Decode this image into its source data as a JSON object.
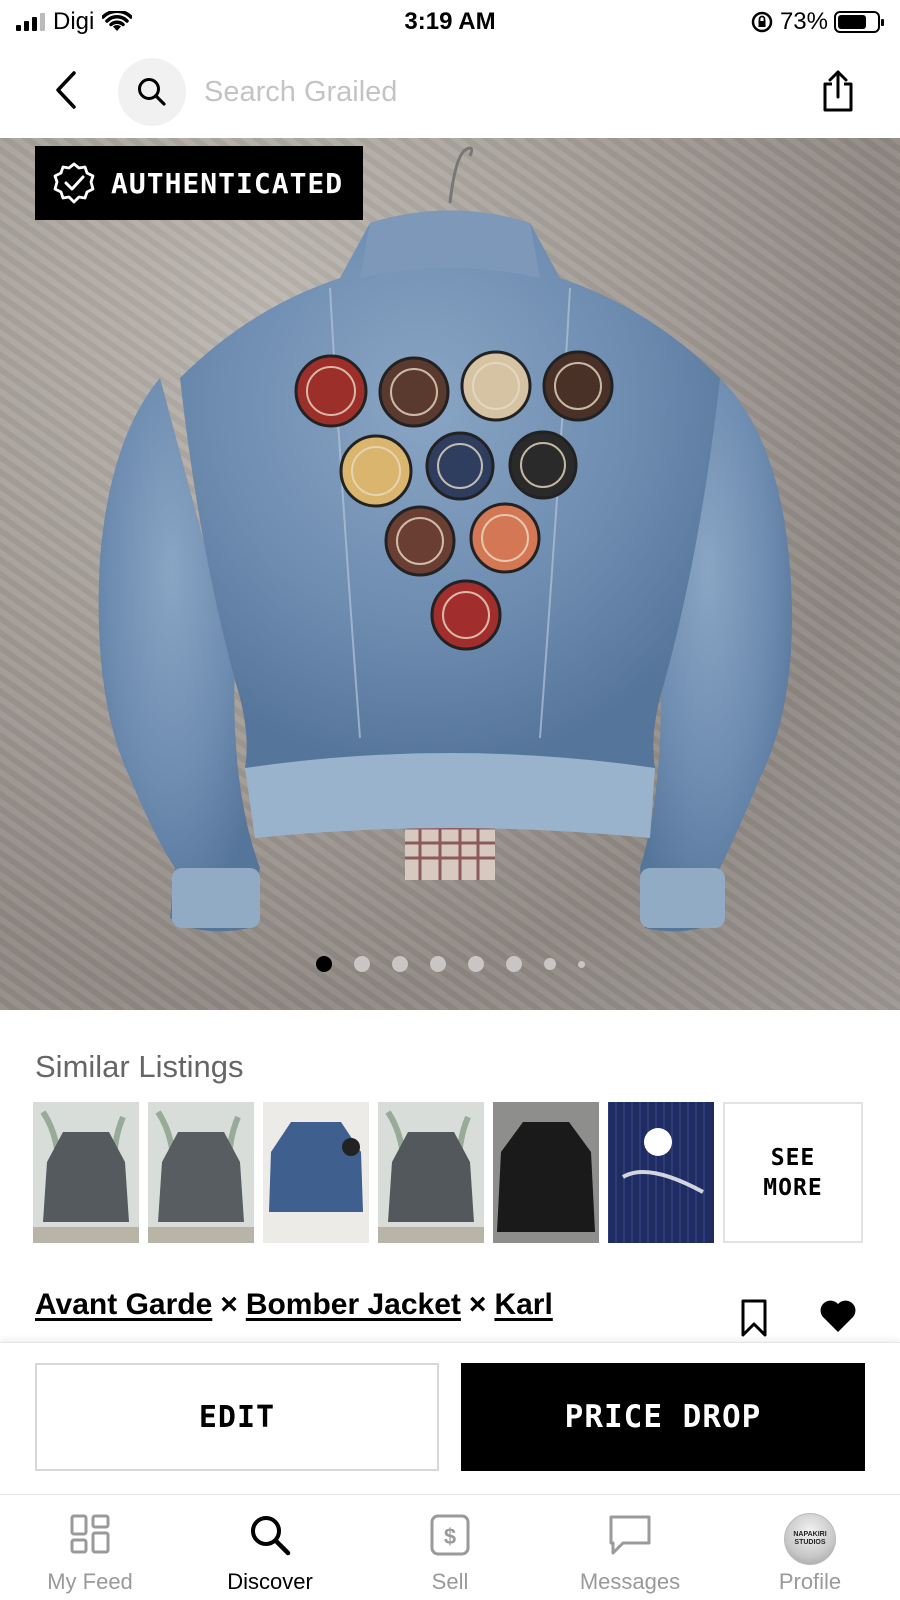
{
  "status_bar": {
    "carrier": "Digi",
    "time": "3:19 AM",
    "battery_percent": "73%",
    "battery_level": 0.73
  },
  "header": {
    "search_placeholder": "Search Grailed",
    "icons": [
      "chevron-left-icon",
      "search-icon",
      "share-icon"
    ]
  },
  "hero": {
    "badge_label": "AUTHENTICATED",
    "image_description_icon": "denim-bomber-jacket-photo",
    "carousel_total": 8,
    "carousel_active_index": 0
  },
  "similar": {
    "title": "Similar Listings",
    "see_more_label": "SEE\nMORE",
    "thumb_count": 6
  },
  "listing": {
    "designers": [
      "Avant Garde",
      "Bomber Jacket",
      "Karl"
    ],
    "separator": "×"
  },
  "actions": {
    "edit_label": "EDIT",
    "price_drop_label": "PRICE DROP"
  },
  "tabs": [
    {
      "label": "My Feed",
      "icon": "grid-icon",
      "active": false
    },
    {
      "label": "Discover",
      "icon": "search-icon",
      "active": true
    },
    {
      "label": "Sell",
      "icon": "dollar-tag-icon",
      "active": false
    },
    {
      "label": "Messages",
      "icon": "chat-bubble-icon",
      "active": false
    },
    {
      "label": "Profile",
      "icon": "avatar-icon",
      "active": false
    }
  ],
  "profile_avatar_text": "NAPAKIRI STUDIOS"
}
